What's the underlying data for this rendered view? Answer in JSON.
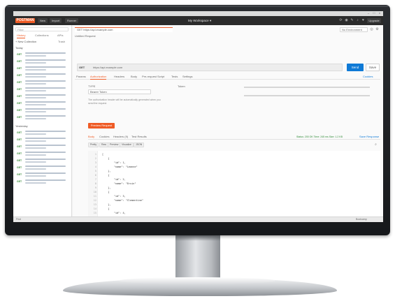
{
  "app": {
    "brand": "POSTMAN",
    "top_buttons": [
      "New",
      "Import",
      "Runner"
    ],
    "workspace": "My Workspace",
    "upgrade": "Upgrade",
    "top_icons": [
      "sync-icon",
      "satellite-icon",
      "wrench-icon",
      "bell-icon",
      "heart-icon"
    ]
  },
  "sidebar": {
    "filter_placeholder": "Filter",
    "tabs": [
      "History",
      "Collections",
      "APIs"
    ],
    "new_collection": "+ New Collection",
    "trash": "Trash",
    "sections": [
      "Today",
      "Yesterday"
    ],
    "item_method": "GET",
    "today_count": 10,
    "yesterday_count": 8
  },
  "main": {
    "request_tab": "GET https://api.example.com",
    "environment": "No Environment",
    "breadcrumb": "Untitled Request",
    "method": "GET",
    "url": "https://api.example.com",
    "send": "Send",
    "save": "Save",
    "request_tabs": [
      "Params",
      "Authorization",
      "Headers",
      "Body",
      "Pre-request Script",
      "Tests",
      "Settings"
    ],
    "active_request_tab": 1,
    "cookies_link": "Cookies",
    "type_label": "TYPE",
    "type_value": "Bearer Token",
    "token_label": "Token",
    "note": "The authorization header will be automatically generated when you send the request.",
    "preview_button": "Preview Request"
  },
  "response": {
    "tabs": [
      "Body",
      "Cookies",
      "Headers (9)",
      "Test Results"
    ],
    "status": "Status: 200 OK   Time: 245 ms   Size: 1.2 KB",
    "save_response": "Save Response",
    "format_buttons": [
      "Pretty",
      "Raw",
      "Preview",
      "Visualize",
      "JSON"
    ],
    "lines": [
      {
        "n": "1",
        "t": "["
      },
      {
        "n": "2",
        "t": "    {"
      },
      {
        "n": "3",
        "t": "        \"id\": 1,"
      },
      {
        "n": "4",
        "t": "        \"name\": \"Leanne\""
      },
      {
        "n": "5",
        "t": "    },"
      },
      {
        "n": "6",
        "t": "    {"
      },
      {
        "n": "7",
        "t": "        \"id\": 2,"
      },
      {
        "n": "8",
        "t": "        \"name\": \"Ervin\""
      },
      {
        "n": "9",
        "t": "    },"
      },
      {
        "n": "10",
        "t": "    {"
      },
      {
        "n": "11",
        "t": "        \"id\": 3,"
      },
      {
        "n": "12",
        "t": "        \"name\": \"Clementine\""
      },
      {
        "n": "13",
        "t": "    },"
      },
      {
        "n": "14",
        "t": "    {"
      },
      {
        "n": "15",
        "t": "        \"id\": 4,"
      }
    ]
  },
  "statusbar": {
    "left": "Find",
    "right": "Bootcamp"
  }
}
